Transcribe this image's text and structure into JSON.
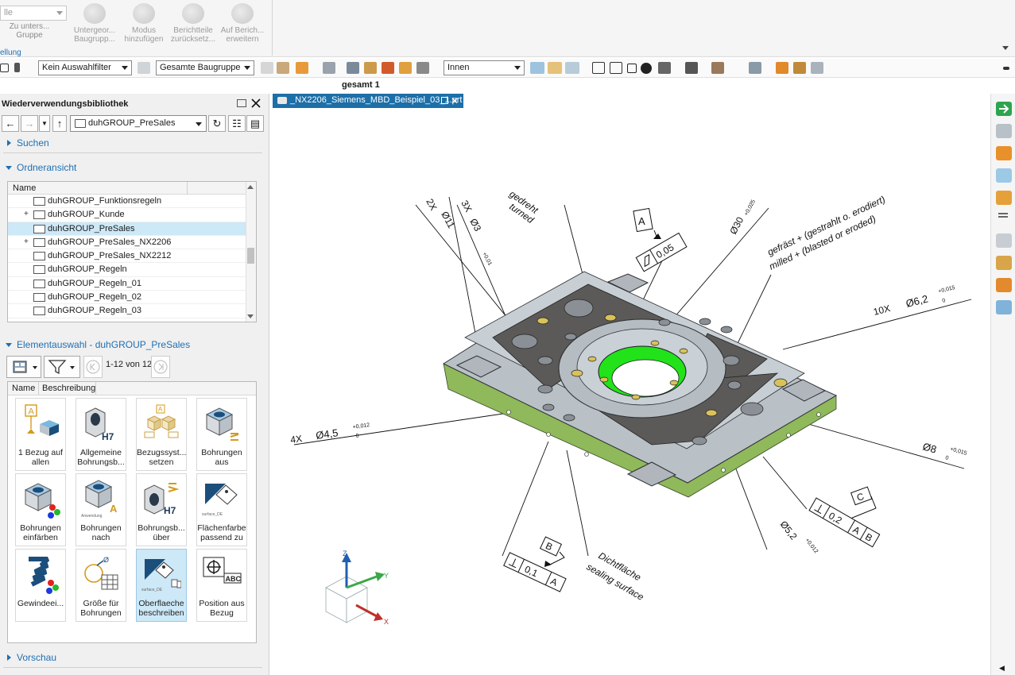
{
  "ribbon": {
    "combo_value": "lle",
    "buttons": [
      {
        "label": "Zu unters... Gruppe",
        "icon": "group-examine-icon"
      },
      {
        "label": "Untergeor... Baugrupp...",
        "icon": "subassembly-icon"
      },
      {
        "label": "Modus hinzufügen",
        "icon": "add-mode-icon"
      },
      {
        "label": "Berichtteile zurücksetz...",
        "icon": "reset-report-icon"
      },
      {
        "label": "Auf Berich... erweitern",
        "icon": "extend-report-icon"
      }
    ],
    "group_label": "ellung"
  },
  "toolbar": {
    "selection_filter": "Kein Auswahlfilter",
    "scope": "Gesamte Baugruppe",
    "snap": "Innen"
  },
  "subtitle": "gesamt 1",
  "library": {
    "title": "Wiederverwendungsbibliothek",
    "path": "duhGROUP_PreSales",
    "search_label": "Suchen",
    "folder_view_label": "Ordneransicht",
    "tree_header": "Name",
    "folders": [
      {
        "name": "duhGROUP_Funktionsregeln",
        "expand": "",
        "selected": false
      },
      {
        "name": "duhGROUP_Kunde",
        "expand": "+",
        "selected": false
      },
      {
        "name": "duhGROUP_PreSales",
        "expand": "",
        "selected": true
      },
      {
        "name": "duhGROUP_PreSales_NX2206",
        "expand": "+",
        "selected": false
      },
      {
        "name": "duhGROUP_PreSales_NX2212",
        "expand": "",
        "selected": false
      },
      {
        "name": "duhGROUP_Regeln",
        "expand": "",
        "selected": false
      },
      {
        "name": "duhGROUP_Regeln_01",
        "expand": "",
        "selected": false
      },
      {
        "name": "duhGROUP_Regeln_02",
        "expand": "",
        "selected": false
      },
      {
        "name": "duhGROUP_Regeln_03",
        "expand": "",
        "selected": false
      }
    ],
    "element_section_label": "Elementauswahl - duhGROUP_PreSales",
    "count": "1-12 von 12",
    "grid_headers": [
      "Name",
      "Beschreibung"
    ],
    "items": [
      {
        "label1": "1 Bezug auf",
        "label2": "allen",
        "icon": "datum-box-icon",
        "selected": false
      },
      {
        "label1": "Allgemeine",
        "label2": "Bohrungsb...",
        "icon": "hole-h7-icon",
        "selected": false
      },
      {
        "label1": "Bezugssyst...",
        "label2": "setzen",
        "icon": "datum-system-icon",
        "selected": false
      },
      {
        "label1": "Bohrungen",
        "label2": "aus",
        "icon": "holes-from-icon",
        "selected": false
      },
      {
        "label1": "Bohrungen",
        "label2": "einfärben",
        "icon": "color-holes-icon",
        "selected": false
      },
      {
        "label1": "Bohrungen",
        "label2": "nach",
        "icon": "holes-by-icon",
        "selected": false
      },
      {
        "label1": "Bohrungsb...",
        "label2": "über",
        "icon": "hole-over-icon",
        "selected": false
      },
      {
        "label1": "Flächenfarbe",
        "label2": "passend zu",
        "icon": "face-color-icon",
        "selected": false
      },
      {
        "label1": "Gewindeei...",
        "label2": "",
        "icon": "thread-icon",
        "selected": false
      },
      {
        "label1": "Größe für",
        "label2": "Bohrungen",
        "icon": "hole-size-icon",
        "selected": false
      },
      {
        "label1": "Oberflaeche",
        "label2": "beschreiben",
        "icon": "surface-describe-icon",
        "selected": true
      },
      {
        "label1": "Position aus",
        "label2": "Bezug",
        "icon": "position-datum-icon",
        "selected": false
      }
    ],
    "tile_small_texts": [
      "Anwendung",
      "surface_DE",
      "surface_DE"
    ],
    "preview_label": "Vorschau"
  },
  "viewport": {
    "tab_title": "_NX2206_Siemens_MBD_Beispiel_03_1.prt",
    "annotations": {
      "turned_de": "gedreht",
      "turned_en": "turned",
      "milled_de": "gefräst + (gestrahlt o. erodiert)",
      "milled_en": "milled + (blasted or eroded)",
      "sealing_de": "Dichtfläche",
      "sealing_en": "sealing surface",
      "dim_2x": "2X",
      "dim_2x_val": "Ø11",
      "dim_3x": "3X",
      "dim_3x_val": "Ø3",
      "dim_30": "Ø30",
      "dim_10x": "10X",
      "dim_10x_val": "Ø6,2",
      "dim_4x": "4X",
      "dim_4x_val": "Ø4,5",
      "dim_8": "Ø8",
      "dim_52": "Ø5,2",
      "tol_pos_012": "+0,012",
      "tol_pos_015": "+0,015",
      "tol_pos_01": "+0,01",
      "tol_pos_025": "+0,025",
      "tol_zero": "0",
      "datum_a": "A",
      "datum_b": "B",
      "datum_c": "C",
      "flatness_val": "0,05",
      "fcf_c_val": "0,2",
      "fcf_c_ref1": "A",
      "fcf_c_ref2": "B",
      "fcf_b_val": "0,1",
      "fcf_b_ref": "A"
    },
    "triad": {
      "x": "X",
      "y": "Y",
      "z": "Z"
    }
  },
  "colors": {
    "accent": "#1d6fa8",
    "part_top": "#b9c0c6",
    "part_side": "#8fb95a",
    "pocket": "#5b5a58",
    "hole_green": "#22e21a"
  }
}
